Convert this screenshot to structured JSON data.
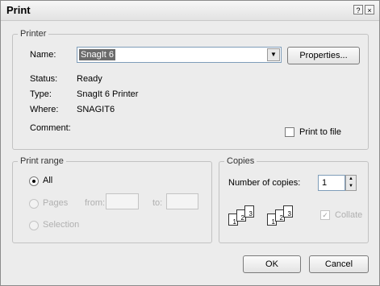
{
  "window": {
    "title": "Print",
    "help_glyph": "?",
    "close_glyph": "×"
  },
  "printer": {
    "legend": "Printer",
    "name_label": "Name:",
    "name_value": "SnagIt 6",
    "properties_button": "Properties...",
    "status_label": "Status:",
    "status_value": "Ready",
    "type_label": "Type:",
    "type_value": "SnagIt 6 Printer",
    "where_label": "Where:",
    "where_value": "SNAGIT6",
    "comment_label": "Comment:",
    "print_to_file": "Print to file"
  },
  "print_range": {
    "legend": "Print range",
    "all": "All",
    "pages": "Pages",
    "from": "from:",
    "to": "to:",
    "selection": "Selection"
  },
  "copies": {
    "legend": "Copies",
    "number_label": "Number of copies:",
    "number_value": "1",
    "collate": "Collate",
    "page_numbers": [
      "1",
      "2",
      "3"
    ]
  },
  "buttons": {
    "ok": "OK",
    "cancel": "Cancel"
  },
  "icons": {
    "dropdown": "chevron-down-icon",
    "check": "✓",
    "spin_up": "▲",
    "spin_down": "▼"
  },
  "colors": {
    "selection_bg": "#6b6b6b",
    "dialog_bg": "#ececec"
  }
}
